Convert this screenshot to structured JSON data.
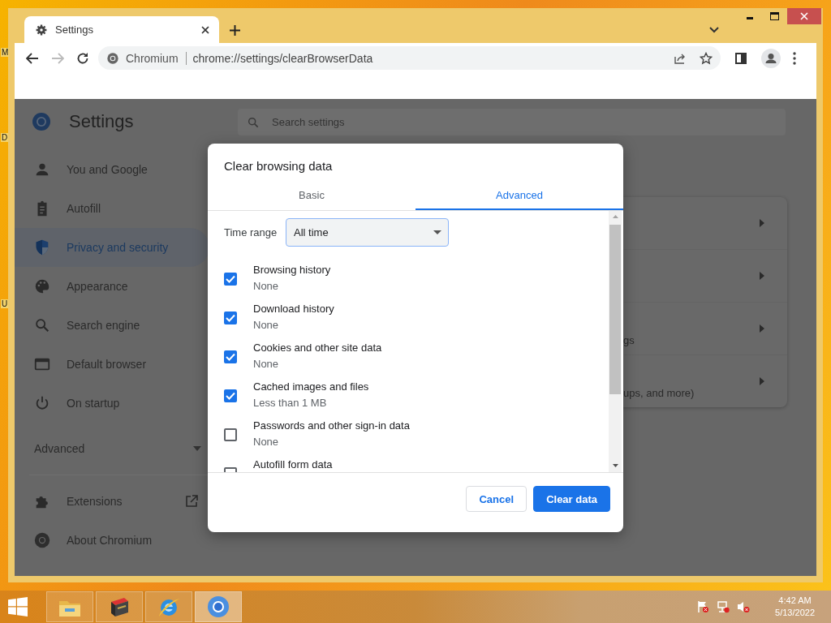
{
  "desktop": {
    "icon_labels": [
      {
        "text": "M",
        "kind": "top"
      },
      {
        "text": "D",
        "kind": "middle"
      },
      {
        "text": "U",
        "kind": "bottom"
      }
    ]
  },
  "browser": {
    "tabs": [
      {
        "title": "Settings",
        "selected": true
      }
    ],
    "address": {
      "site": "Chromium",
      "url": "chrome://settings/clearBrowserData"
    }
  },
  "settings": {
    "title": "Settings",
    "search": {
      "placeholder": "Search settings"
    },
    "nav": [
      {
        "label": "You and Google",
        "kind": "person",
        "selected": false
      },
      {
        "label": "Autofill",
        "kind": "clipboard",
        "selected": false
      },
      {
        "label": "Privacy and security",
        "kind": "shield",
        "selected": true
      },
      {
        "label": "Appearance",
        "kind": "palette",
        "selected": false
      },
      {
        "label": "Search engine",
        "kind": "search",
        "selected": false
      },
      {
        "label": "Default browser",
        "kind": "browser",
        "selected": false
      },
      {
        "label": "On startup",
        "kind": "power",
        "selected": false
      }
    ],
    "advanced": {
      "label": "Advanced",
      "expanded": false
    },
    "more_nav": [
      {
        "label": "Extensions",
        "kind": "puzzle",
        "external": true
      },
      {
        "label": "About Chromium",
        "kind": "chromium",
        "external": false
      }
    ],
    "card": {
      "rows": [
        {
          "kind": "plain"
        },
        {
          "kind": "plain"
        },
        {
          "kind": "text",
          "text": "gs"
        },
        {
          "kind": "text",
          "text": "ups, and more)"
        }
      ]
    }
  },
  "dialog": {
    "title": "Clear browsing data",
    "tabs": [
      {
        "label": "Basic",
        "selected": false
      },
      {
        "label": "Advanced",
        "selected": true
      }
    ],
    "time_range": {
      "label": "Time range",
      "value": "All time"
    },
    "items": [
      {
        "title": "Browsing history",
        "detail": "None",
        "checked": true
      },
      {
        "title": "Download history",
        "detail": "None",
        "checked": true
      },
      {
        "title": "Cookies and other site data",
        "detail": "None",
        "checked": true
      },
      {
        "title": "Cached images and files",
        "detail": "Less than 1 MB",
        "checked": true
      },
      {
        "title": "Passwords and other sign-in data",
        "detail": "None",
        "checked": false
      },
      {
        "title": "Autofill form data",
        "checked": false
      }
    ],
    "buttons": [
      {
        "label": "Cancel",
        "kind": "secondary"
      },
      {
        "label": "Clear data",
        "kind": "primary"
      }
    ]
  },
  "taskbar": {
    "apps": [
      {
        "kind": "folder",
        "selected": false
      },
      {
        "kind": "archive",
        "selected": false
      },
      {
        "kind": "ie",
        "selected": false
      },
      {
        "kind": "chromium",
        "selected": true
      }
    ],
    "time": "4:42 AM",
    "date": "5/13/2022"
  }
}
